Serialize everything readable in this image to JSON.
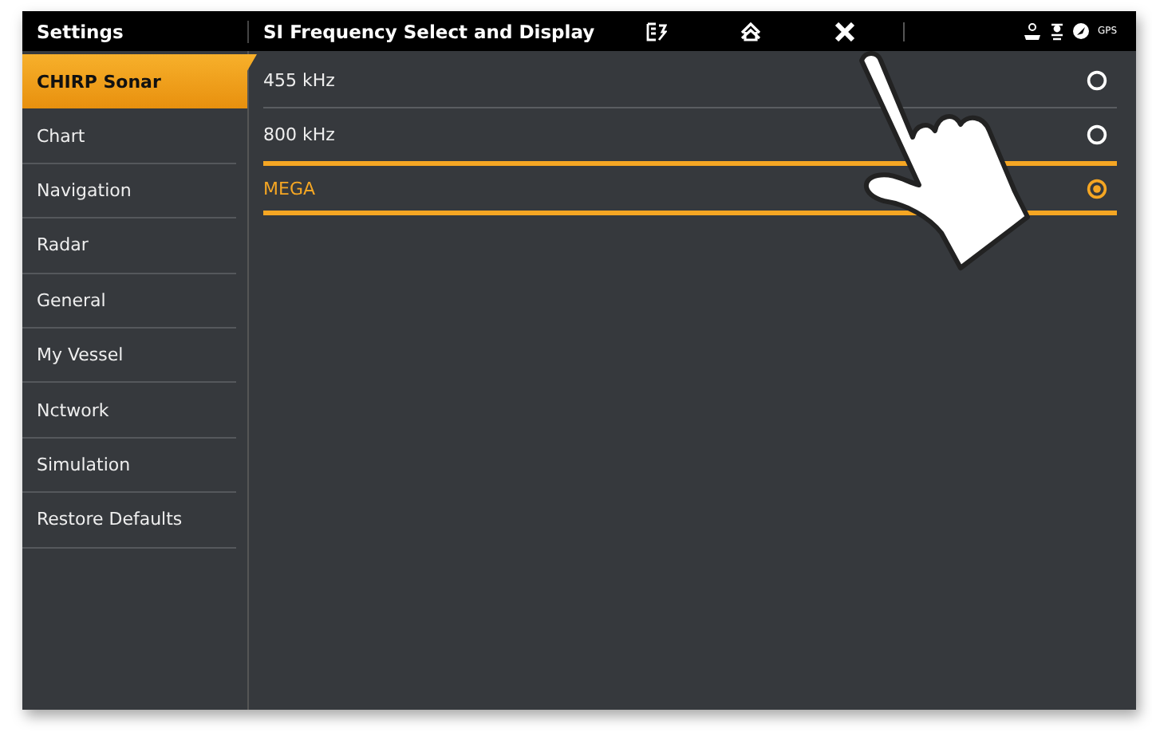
{
  "header": {
    "section_title": "Settings",
    "page_title": "SI Frequency Select and Display",
    "status": {
      "gps_label": "GPS"
    }
  },
  "sidebar": {
    "items": [
      {
        "label": "CHIRP Sonar",
        "selected": true
      },
      {
        "label": "Chart",
        "selected": false
      },
      {
        "label": "Navigation",
        "selected": false
      },
      {
        "label": "Radar",
        "selected": false
      },
      {
        "label": "General",
        "selected": false
      },
      {
        "label": "My Vessel",
        "selected": false
      },
      {
        "label": "Nctwork",
        "selected": false
      },
      {
        "label": "Simulation",
        "selected": false
      },
      {
        "label": "Restore Defaults",
        "selected": false
      }
    ]
  },
  "options": [
    {
      "label": "455 kHz",
      "selected": false
    },
    {
      "label": "800 kHz",
      "selected": false
    },
    {
      "label": "MEGA",
      "selected": true
    }
  ]
}
